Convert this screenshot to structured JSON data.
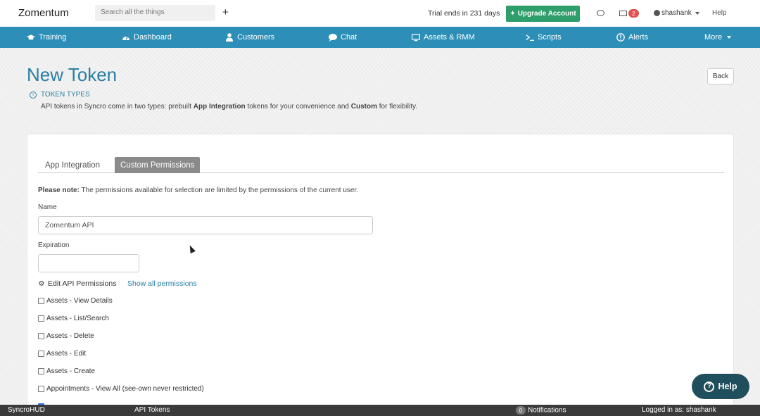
{
  "topbar": {
    "brand": "Zomentum",
    "search_placeholder": "Search all the things",
    "plus_label": "+",
    "trial_text": "Trial ends in 231 days",
    "upgrade_label": "Upgrade Account",
    "upgrade_icon": "sparkle-icon",
    "chat_icon": "speech-bubble-icon",
    "news_icon": "newspaper-icon",
    "news_badge": "2",
    "user_name": "shashank",
    "help_label": "Help"
  },
  "nav": {
    "items": [
      {
        "label": "Training",
        "icon": "graduation-cap-icon"
      },
      {
        "label": "Dashboard",
        "icon": "dashboard-gauge-icon"
      },
      {
        "label": "Customers",
        "icon": "user-icon"
      },
      {
        "label": "Chat",
        "icon": "chat-bubble-icon"
      },
      {
        "label": "Assets & RMM",
        "icon": "monitor-icon"
      },
      {
        "label": "Scripts",
        "icon": "terminal-icon"
      },
      {
        "label": "Alerts",
        "icon": "alert-circle-icon"
      },
      {
        "label": "More",
        "icon": "caret-down-icon"
      }
    ],
    "color": "#2d8fb8"
  },
  "page": {
    "title": "New Token",
    "back_label": "Back",
    "token_types_label": "TOKEN TYPES",
    "desc_part1": "API tokens in Syncro come in two types: prebuilt ",
    "desc_bold1": "App Integration",
    "desc_part2": " tokens for your convenience and ",
    "desc_bold2": "Custom",
    "desc_part3": " for flexibility."
  },
  "form": {
    "tabs": [
      {
        "label": "App Integration",
        "active": false
      },
      {
        "label": "Custom Permissions",
        "active": true
      }
    ],
    "note_bold": "Please note:",
    "note_text": " The permissions available for selection are limited by the permissions of the current user.",
    "name_label": "Name",
    "name_value": "Zomentum API",
    "expiration_label": "Expiration",
    "expiration_value": "",
    "edit_permissions_label": "Edit API Permissions",
    "show_all_label": "Show all permissions",
    "permissions": [
      {
        "label": "Assets - View Details",
        "checked": false
      },
      {
        "label": "Assets - List/Search",
        "checked": false
      },
      {
        "label": "Assets - Delete",
        "checked": false
      },
      {
        "label": "Assets - Edit",
        "checked": false
      },
      {
        "label": "Assets - Create",
        "checked": false
      },
      {
        "label": "Appointments - View All (see-own never restricted)",
        "checked": false
      }
    ]
  },
  "help_float": {
    "label": "Help"
  },
  "footer": {
    "left": "SyncroHUD",
    "page": "API Tokens",
    "notif_count": "0",
    "notif_label": "Notifications",
    "logged_in": "Logged in as: shashank"
  },
  "colors": {
    "accent": "#2a7fa3",
    "upgrade_green": "#2e9e6a",
    "footer": "#3a3a3a",
    "help_button": "#1f4f5c"
  }
}
